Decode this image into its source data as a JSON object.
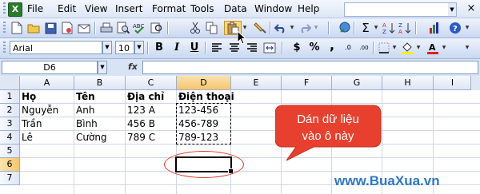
{
  "menubar": {
    "items": [
      "File",
      "Edit",
      "View",
      "Insert",
      "Format",
      "Tools",
      "Data",
      "Window",
      "Help"
    ],
    "close_glyph": "×"
  },
  "toolbar_standard": {
    "buttons": [
      "new-icon",
      "open-icon",
      "save-icon",
      "permission-icon",
      "email-icon",
      "print-icon",
      "print-preview-icon",
      "spelling-icon",
      "research-icon",
      "cut-icon",
      "copy-icon",
      "paste-icon",
      "format-painter-icon",
      "undo-icon",
      "redo-icon",
      "hyperlink-icon",
      "autosum-icon",
      "sort-ascending-icon",
      "sort-descending-icon",
      "chart-wizard-icon",
      "help-icon"
    ],
    "autosum_glyph": "Σ"
  },
  "toolbar_formatting": {
    "font": "Arial",
    "size": "10",
    "bold": "B",
    "italic": "I",
    "underline": "U",
    "currency": "$",
    "percent": "%",
    "comma": ",",
    "increase_decimal": ".0",
    "decrease_decimal": ".00"
  },
  "formula_bar": {
    "name_box": "D6",
    "fx": "fx",
    "formula": ""
  },
  "sheet": {
    "columns": [
      "A",
      "B",
      "C",
      "D",
      "E",
      "F",
      "G",
      "H",
      "I"
    ],
    "rows": [
      "1",
      "2",
      "3",
      "4",
      "5",
      "6",
      "7"
    ],
    "active_cell": "D6",
    "copied_range": "D1:D4",
    "data": {
      "A1": "Họ",
      "B1": "Tên",
      "C1": "Địa chỉ",
      "D1": "Điện thoại",
      "A2": "Nguyễn",
      "B2": "Anh",
      "C2": "123 A",
      "D2": "123-456",
      "A3": "Trần",
      "B3": "Bình",
      "C3": "456 B",
      "D3": "456-789",
      "A4": "Lê",
      "B4": "Cường",
      "C4": "789 C",
      "D4": "789-123"
    }
  },
  "callout": {
    "line1": "Dán dữ liệu",
    "line2": "vào ô này",
    "color": "#e8402e"
  },
  "watermark": "www.BuaXua.vn"
}
